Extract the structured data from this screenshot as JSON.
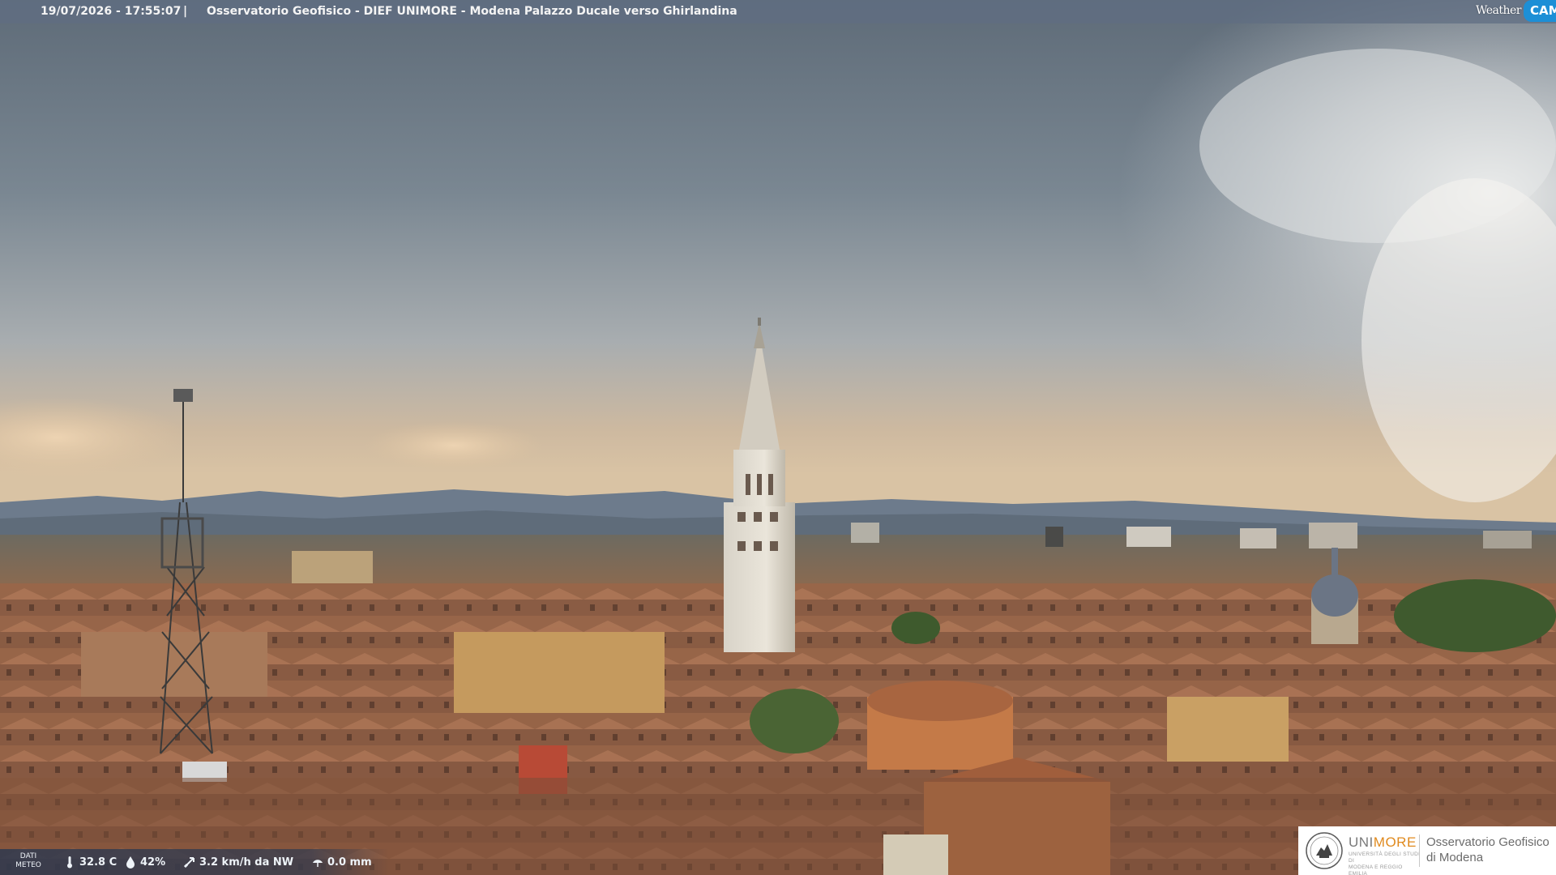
{
  "header": {
    "timestamp": "19/07/2026 - 17:55:07",
    "separator": "|",
    "title": "Osservatorio Geofisico - DIEF UNIMORE - Modena Palazzo Ducale verso Ghirlandina"
  },
  "weathercam_logo": {
    "word1": "Weather",
    "word2": "CAM",
    "accent_color": "#1d8fd6"
  },
  "meteo": {
    "label": "DATI METEO",
    "label_line1": "DATI",
    "label_line2": "METEO",
    "temperature": "32.8 C",
    "temperature_icon": "thermometer-icon",
    "humidity": "42%",
    "humidity_icon": "humidity-drop-icon",
    "wind": "3.2 km/h da NW",
    "wind_icon": "wind-direction-icon",
    "rain": "0.0 mm",
    "rain_icon": "rain-gauge-icon"
  },
  "institution_logo": {
    "uni_part1": "UNI",
    "uni_part2": "MORE",
    "sub_line1": "UNIVERSITÀ DEGLI STUDI DI",
    "sub_line2": "MODENA E REGGIO EMILIA",
    "observatory_line1": "Osservatorio Geofisico",
    "observatory_line2": "di Modena",
    "accent_color": "#e08a1e"
  },
  "scene": {
    "description_icon": "city-skyline-photo"
  }
}
